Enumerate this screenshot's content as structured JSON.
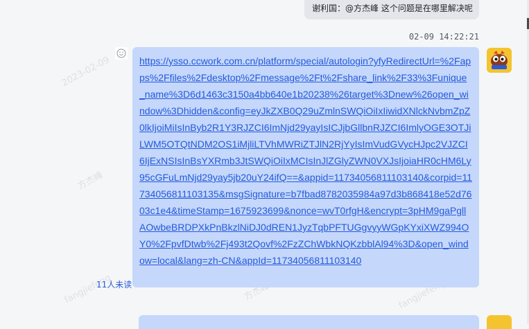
{
  "previous_message": {
    "text": "谢利国：@方杰峰 这个问题是在哪里解决呢"
  },
  "timestamp": "02-09 14:22:21",
  "message": {
    "link": "https://ysso.ccwork.com.cn/platform/special/autologin?yfyRedirectUrl=%2Fapps%2Ffiles%2Fdesktop%2Fmessage%2Ft%2Fshare_link%2F33%3Funique_name%3D6d1463c3150a4bb640e1b20238%26target%3Dnew%26open_window%3Dhidden&config=eyJkZXB0Q29uZmlnSWQiOiIxIiwidXNlckNvbmZpZ0lkIjoiMiIsInByb2R1Y3RJZCI6ImNjd29yayIsICJjbGllbnRJZCI6ImlyOGE3OTJiLWM5OTQtNDM2OS1iMjliLTVhMWRiZTJlN2RjYyIsImVudGVycHJpc2VJZCI6IjExNSIsInBsYXRmb3JtSWQiOiIxMCIsInJlZGlyZWN0VXJsIjoiaHR0cHM6Ly95cGFuLmNjd29yay5jb20uY24ifQ==&appid=11734056811103140&corpid=11734056811103135&msgSignature=b7fbad8782035984a97d3b868418e52d7603c1e4&timeStamp=1675923699&nonce=wvT0rfgH&encrypt=3pHM9gaPgllAOwbeBRDPXkPnBkzlNiDJ0dREN1JyzTqbPFTUGgvyyWGpKYxiXWZ994OY0%2FpvfDtwb%2Fj493t2Qovf%2FzZChWbkNQKzbblAl94%3D&open_window=local&lang=zh-CN&appId=11734056811103140"
  },
  "read_status": "11人未读",
  "watermarks": [
    "2023-02-09",
    "方杰峰",
    "fangjiefeng"
  ],
  "icons": {
    "reaction": "smiley-face-icon",
    "avatar": "cartoon-character-avatar"
  },
  "colors": {
    "bubble": "#c5d7fb",
    "link": "#245bdb",
    "avatar_bg": "#f4c430"
  }
}
